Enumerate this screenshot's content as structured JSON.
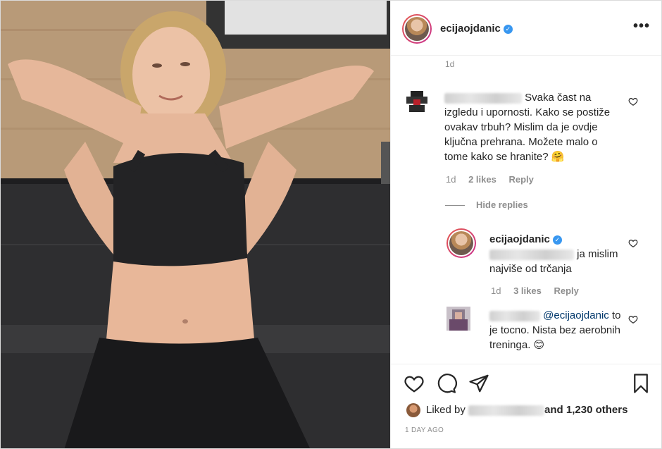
{
  "post": {
    "username": "ecijaojdanic",
    "verified_mark": "✓",
    "more_icon": "more-options-icon",
    "more_glyph": "•••"
  },
  "comments": {
    "top_time": "1d",
    "first": {
      "text": "Svaka čast na izgledu i upornosti. Kako se postiže ovakav trbuh? Mislim da je ovdje ključna prehrana. Možete malo o tome kako se hranite? 🤗",
      "time": "1d",
      "likes": "2 likes",
      "reply": "Reply"
    },
    "hide_replies": "Hide replies",
    "reply_one": {
      "username": "ecijaojdanic",
      "text": "ja mislim najviše od trčanja",
      "time": "1d",
      "likes": "3 likes",
      "reply": "Reply"
    },
    "reply_two": {
      "mention": "@ecijaojdanic",
      "text": "to je tocno. Nista bez aerobnih treninga. 😊"
    }
  },
  "actions": {
    "icons": [
      "heart-icon",
      "comment-icon",
      "share-icon",
      "bookmark-icon"
    ],
    "liked_by_prefix": "Liked by",
    "liked_by_suffix": "and 1,230 others",
    "age": "1 DAY AGO"
  },
  "colors": {
    "accent_blue": "#3897f0",
    "mention_blue": "#00376b",
    "muted": "#8e8e8e",
    "text": "#262626"
  }
}
